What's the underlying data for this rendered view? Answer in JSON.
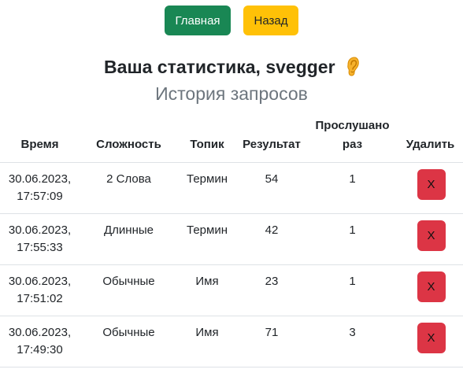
{
  "nav": {
    "home_label": "Главная",
    "back_label": "Назад"
  },
  "page_title": "Ваша статистика, svegger",
  "history_title": "История запросов",
  "table": {
    "headers": {
      "time": "Время",
      "difficulty": "Сложность",
      "topic": "Топик",
      "result": "Результат",
      "listened": "Прослушано раз",
      "delete": "Удалить"
    },
    "rows": [
      {
        "date": "30.06.2023,",
        "time": "17:57:09",
        "difficulty": "2 Слова",
        "topic": "Термин",
        "result": "54",
        "listened": "1",
        "delete_label": "X"
      },
      {
        "date": "30.06.2023,",
        "time": "17:55:33",
        "difficulty": "Длинные",
        "topic": "Термин",
        "result": "42",
        "listened": "1",
        "delete_label": "X"
      },
      {
        "date": "30.06.2023,",
        "time": "17:51:02",
        "difficulty": "Обычные",
        "topic": "Имя",
        "result": "23",
        "listened": "1",
        "delete_label": "X"
      },
      {
        "date": "30.06.2023,",
        "time": "17:49:30",
        "difficulty": "Обычные",
        "topic": "Имя",
        "result": "71",
        "listened": "3",
        "delete_label": "X"
      }
    ]
  },
  "icons": {
    "title_icon": "ear-icon"
  },
  "colors": {
    "home": "#198754",
    "back": "#ffc107",
    "delete": "#dc3545",
    "muted": "#6c757d"
  }
}
